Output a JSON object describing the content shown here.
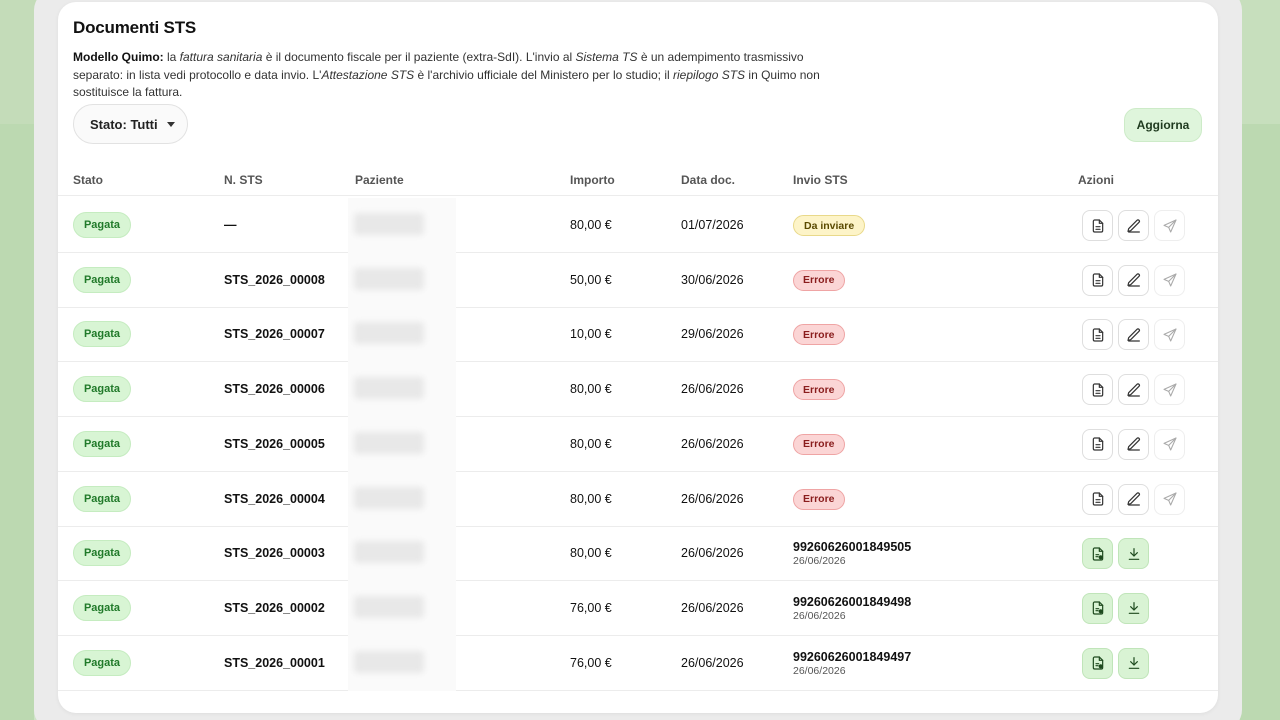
{
  "title": "Documenti STS",
  "description": {
    "lead": "Modello Quimo:",
    "p1": " la ",
    "i1": "fattura sanitaria",
    "p2": " è il documento fiscale per il paziente (extra-SdI). L'invio al ",
    "i2": "Sistema TS",
    "p3": " è un adempimento trasmissivo separato: in lista vedi protocollo e data invio. L'",
    "i3": "Attestazione STS",
    "p4": " è l'archivio ufficiale del Ministero per lo studio; il ",
    "i4": "riepilogo STS",
    "p5": " in Quimo non sostituisce la fattura."
  },
  "filter_label": "Stato: Tutti",
  "refresh_label": "Aggiorna",
  "columns": [
    "Stato",
    "N. STS",
    "Paziente",
    "Importo",
    "Data doc.",
    "Invio STS",
    "Azioni"
  ],
  "colors": {
    "success_bg": "#d8f5d4",
    "error_bg": "#fbd5d5",
    "warning_bg": "#fdf4c8"
  },
  "rows": [
    {
      "stato": "Pagata",
      "nsts": "—",
      "importo": "80,00 €",
      "data": "01/07/2026",
      "invio_type": "badge-warning",
      "invio": "Da inviare",
      "actions": [
        "document-icon",
        "pencil-icon",
        "send-icon"
      ]
    },
    {
      "stato": "Pagata",
      "nsts": "STS_2026_00008",
      "importo": "50,00 €",
      "data": "30/06/2026",
      "invio_type": "badge-error",
      "invio": "Errore",
      "actions": [
        "document-icon",
        "pencil-icon",
        "send-icon"
      ]
    },
    {
      "stato": "Pagata",
      "nsts": "STS_2026_00007",
      "importo": "10,00 €",
      "data": "29/06/2026",
      "invio_type": "badge-error",
      "invio": "Errore",
      "actions": [
        "document-icon",
        "pencil-icon",
        "send-icon"
      ]
    },
    {
      "stato": "Pagata",
      "nsts": "STS_2026_00006",
      "importo": "80,00 €",
      "data": "26/06/2026",
      "invio_type": "badge-error",
      "invio": "Errore",
      "actions": [
        "document-icon",
        "pencil-icon",
        "send-icon"
      ]
    },
    {
      "stato": "Pagata",
      "nsts": "STS_2026_00005",
      "importo": "80,00 €",
      "data": "26/06/2026",
      "invio_type": "badge-error",
      "invio": "Errore",
      "actions": [
        "document-icon",
        "pencil-icon",
        "send-icon"
      ]
    },
    {
      "stato": "Pagata",
      "nsts": "STS_2026_00004",
      "importo": "80,00 €",
      "data": "26/06/2026",
      "invio_type": "badge-error",
      "invio": "Errore",
      "actions": [
        "document-icon",
        "pencil-icon",
        "send-icon"
      ]
    },
    {
      "stato": "Pagata",
      "nsts": "STS_2026_00003",
      "importo": "80,00 €",
      "data": "26/06/2026",
      "invio_type": "protocol",
      "invio": "99260626001849505",
      "invio_date": "26/06/2026",
      "actions": [
        "attestation-icon",
        "download-icon"
      ]
    },
    {
      "stato": "Pagata",
      "nsts": "STS_2026_00002",
      "importo": "76,00 €",
      "data": "26/06/2026",
      "invio_type": "protocol",
      "invio": "99260626001849498",
      "invio_date": "26/06/2026",
      "actions": [
        "attestation-icon",
        "download-icon"
      ]
    },
    {
      "stato": "Pagata",
      "nsts": "STS_2026_00001",
      "importo": "76,00 €",
      "data": "26/06/2026",
      "invio_type": "protocol",
      "invio": "99260626001849497",
      "invio_date": "26/06/2026",
      "actions": [
        "attestation-icon",
        "download-icon"
      ]
    }
  ]
}
